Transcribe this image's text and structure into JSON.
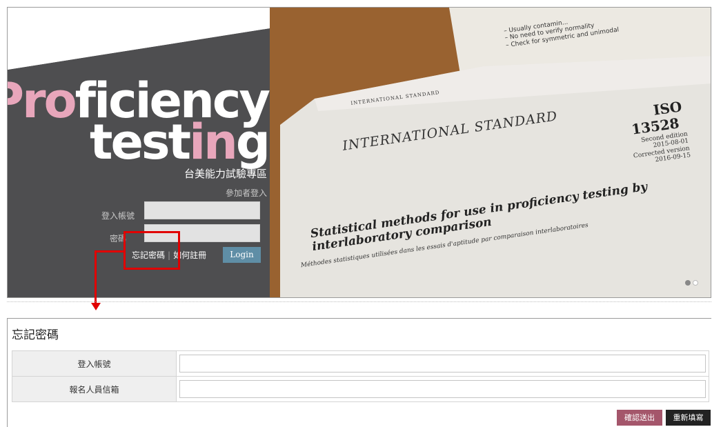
{
  "hero": {
    "brand_line1_pink": "Pro",
    "brand_line1_white": "ficiency",
    "brand_line2_white1": "test",
    "brand_line2_pink": "in",
    "brand_line2_white2": "g",
    "portal_title": "台美能力試驗專區",
    "login_subtitle": "參加者登入",
    "username_label": "登入帳號",
    "password_label": "密碼",
    "forgot_link": "忘記密碼",
    "separator": "|",
    "register_link": "如何註冊",
    "login_button": "Login"
  },
  "paper": {
    "intl_small": "INTERNATIONAL STANDARD",
    "intl_big": "INTERNATIONAL STANDARD",
    "iso": "ISO",
    "iso_number": "13528",
    "edition": "Second edition",
    "edition_date": "2015-08-01",
    "corrected": "Corrected version",
    "corrected_date": "2016-09-15",
    "title_line1": "Statistical methods for use in proficiency testing by",
    "title_line2": "interlaboratory comparison",
    "subtitle_fr": "Méthodes statistiques utilisées dans les essais d'aptitude par comparaison interlaboratoires",
    "note1": "– Usually contamin...",
    "note2": "– No need to verify normality",
    "note3": "– Check for symmetric and unimodal"
  },
  "forgot": {
    "title": "忘記密碼",
    "row1_label": "登入帳號",
    "row2_label": "報名人員信箱",
    "submit_button": "確認送出",
    "reset_button": "重新填寫"
  },
  "colors": {
    "accent_pink": "#e8a6bb",
    "login_blue": "#5f8ea6",
    "submit_maroon": "#a4566b",
    "annotation_red": "#e10000"
  }
}
